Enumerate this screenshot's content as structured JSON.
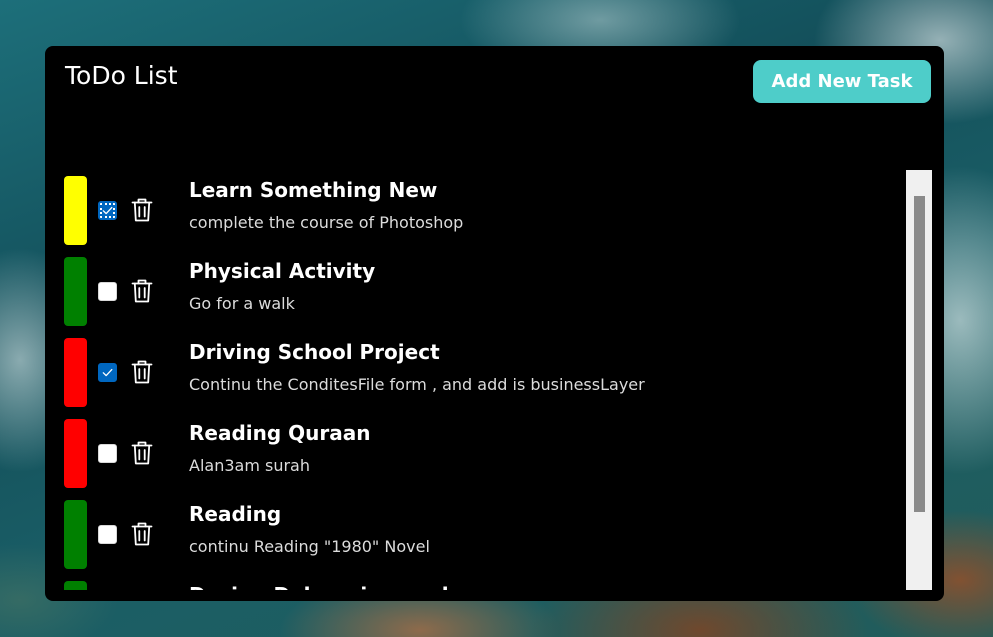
{
  "app": {
    "title": "ToDo List",
    "add_button_label": "Add New Task"
  },
  "colors": {
    "accent": "#4ecdc9",
    "window_background": "#000000",
    "checkbox_checked": "#0067c0",
    "priority_yellow": "#ffff00",
    "priority_green": "#008000",
    "priority_red": "#ff0000"
  },
  "icons": {
    "delete": "trash-icon",
    "checked": "checkmark-icon"
  },
  "tasks": [
    {
      "title": "Learn Something New",
      "description": "complete the course of Photoshop",
      "color": "#ffff00",
      "done": true
    },
    {
      "title": "Physical Activity",
      "description": "Go for a walk",
      "color": "#008000",
      "done": false
    },
    {
      "title": "Driving School Project",
      "description": "Continu the ConditesFile form , and add is businessLayer",
      "color": "#ff0000",
      "done": true
    },
    {
      "title": "Reading Quraan",
      "description": "Alan3am surah",
      "color": "#ff0000",
      "done": false
    },
    {
      "title": "Reading",
      "description": "continu Reading \"1980\" Novel",
      "color": "#008000",
      "done": false
    },
    {
      "title": "Design Delaveries work",
      "description": "",
      "color": "#008000",
      "done": false
    }
  ]
}
